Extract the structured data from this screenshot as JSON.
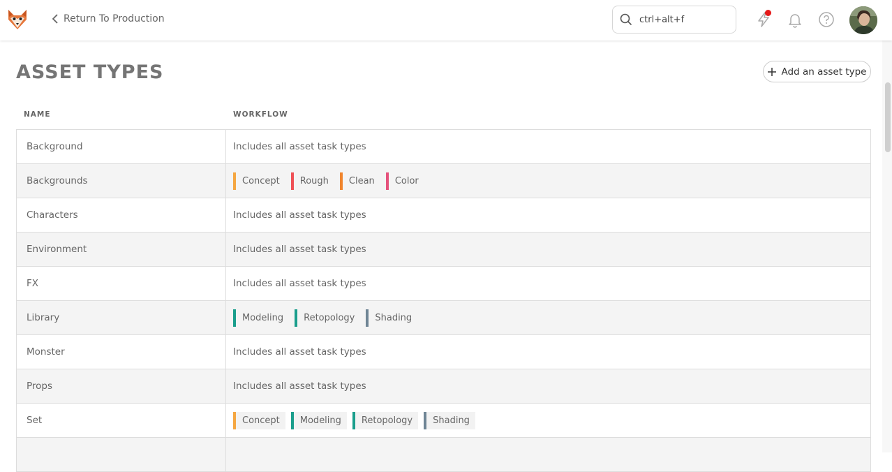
{
  "topbar": {
    "back_label": "Return To Production",
    "search_value": "ctrl+alt+f"
  },
  "page": {
    "title": "ASSET TYPES",
    "add_button": "Add an asset type"
  },
  "table": {
    "columns": [
      "NAME",
      "WORKFLOW"
    ],
    "rows": [
      {
        "name": "Background",
        "workflow": "Includes all asset task types"
      },
      {
        "name": "Backgrounds",
        "tasks": [
          {
            "label": "Concept",
            "color": "#f5a742"
          },
          {
            "label": "Rough",
            "color": "#ef5156"
          },
          {
            "label": "Clean",
            "color": "#f0852d"
          },
          {
            "label": "Color",
            "color": "#e5527c"
          }
        ]
      },
      {
        "name": "Characters",
        "workflow": "Includes all asset task types"
      },
      {
        "name": "Environment",
        "workflow": "Includes all asset task types"
      },
      {
        "name": "FX",
        "workflow": "Includes all asset task types"
      },
      {
        "name": "Library",
        "tasks": [
          {
            "label": "Modeling",
            "color": "#1a9e8c"
          },
          {
            "label": "Retopology",
            "color": "#1a9e8c"
          },
          {
            "label": "Shading",
            "color": "#6f8595"
          }
        ]
      },
      {
        "name": "Monster",
        "workflow": "Includes all asset task types"
      },
      {
        "name": "Props",
        "workflow": "Includes all asset task types"
      },
      {
        "name": "Set",
        "tasks": [
          {
            "label": "Concept",
            "color": "#f5a742"
          },
          {
            "label": "Modeling",
            "color": "#1a9e8c"
          },
          {
            "label": "Retopology",
            "color": "#1a9e8c"
          },
          {
            "label": "Shading",
            "color": "#6f8595"
          }
        ]
      },
      {
        "name": "",
        "workflow": ""
      }
    ]
  },
  "icons": {
    "logo": "fox-logo-icon",
    "back": "chevron-left-icon",
    "search": "search-icon",
    "news": "lightning-icon",
    "notifications": "bell-icon",
    "help": "help-circle-icon",
    "add": "plus-icon"
  },
  "colors": {
    "notification_dot": "#e51919"
  }
}
